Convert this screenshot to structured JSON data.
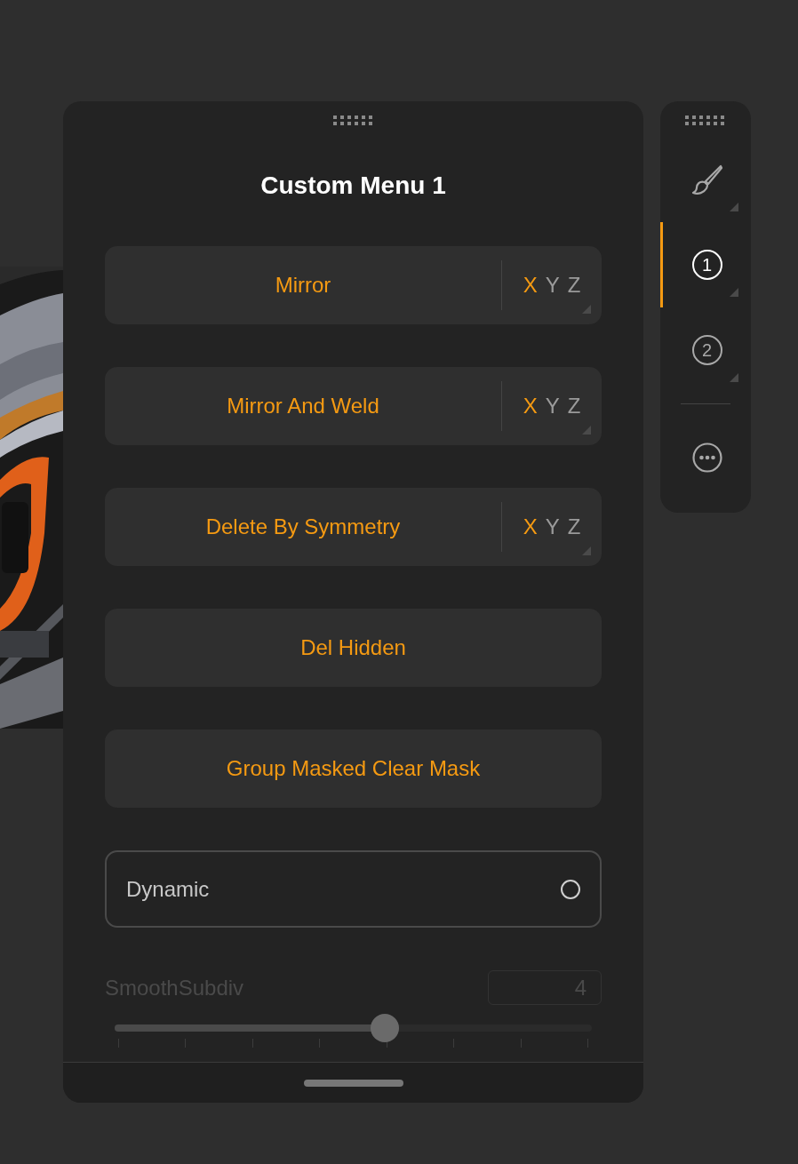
{
  "panel": {
    "title": "Custom Menu 1",
    "buttons": [
      {
        "kind": "axis",
        "label": "Mirror",
        "axes": [
          {
            "label": "X",
            "selected": true
          },
          {
            "label": "Y",
            "selected": false
          },
          {
            "label": "Z",
            "selected": false
          }
        ]
      },
      {
        "kind": "axis",
        "label": "Mirror And Weld",
        "axes": [
          {
            "label": "X",
            "selected": true
          },
          {
            "label": "Y",
            "selected": false
          },
          {
            "label": "Z",
            "selected": false
          }
        ]
      },
      {
        "kind": "axis",
        "label": "Delete By Symmetry",
        "axes": [
          {
            "label": "X",
            "selected": true
          },
          {
            "label": "Y",
            "selected": false
          },
          {
            "label": "Z",
            "selected": false
          }
        ]
      },
      {
        "kind": "plain",
        "label": "Del Hidden"
      },
      {
        "kind": "plain",
        "label": "Group Masked Clear Mask"
      }
    ],
    "toggle": {
      "label": "Dynamic",
      "on": false
    },
    "slider": {
      "label": "SmoothSubdiv",
      "value": "4",
      "disabled": true,
      "level": 0.57
    }
  },
  "sidebar": {
    "tabs": [
      {
        "kind": "brush",
        "selected": false
      },
      {
        "kind": "number",
        "label": "1",
        "selected": true
      },
      {
        "kind": "number",
        "label": "2",
        "selected": false
      },
      {
        "kind": "more",
        "selected": false
      }
    ]
  }
}
